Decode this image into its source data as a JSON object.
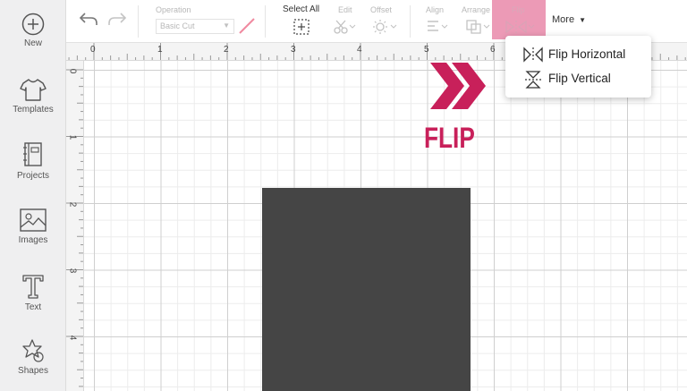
{
  "sidebar": {
    "items": [
      {
        "label": "New",
        "icon": "plus-circle-icon"
      },
      {
        "label": "Templates",
        "icon": "tshirt-icon"
      },
      {
        "label": "Projects",
        "icon": "notebook-icon"
      },
      {
        "label": "Images",
        "icon": "image-icon"
      },
      {
        "label": "Text",
        "icon": "text-t-icon"
      },
      {
        "label": "Shapes",
        "icon": "shapes-icon"
      }
    ]
  },
  "toolbar": {
    "undo_icon": "undo-icon",
    "redo_icon": "redo-icon",
    "operation_label": "Operation",
    "operation_value": "Basic Cut",
    "select_all_label": "Select All",
    "edit_label": "Edit",
    "offset_label": "Offset",
    "align_label": "Align",
    "arrange_label": "Arrange",
    "flip_label": "Flip",
    "more_label": "More",
    "highlight_color": "#ec9ab6"
  },
  "ruler": {
    "top": [
      "0",
      "1",
      "2",
      "3",
      "4",
      "5",
      "6"
    ],
    "left": [
      "0",
      "1",
      "2",
      "3",
      "4"
    ]
  },
  "dropdown": {
    "items": [
      {
        "label": "Flip Horizontal",
        "icon": "flip-horizontal-icon"
      },
      {
        "label": "Flip Vertical",
        "icon": "flip-vertical-icon"
      }
    ]
  },
  "annotation": {
    "text": "FLIP",
    "color": "#c8205a"
  },
  "canvas": {
    "shape_color": "#454545"
  }
}
